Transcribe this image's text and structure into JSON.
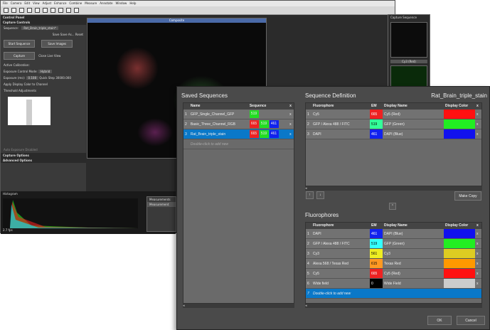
{
  "app": {
    "menu": [
      "File",
      "Camera",
      "Edit",
      "View",
      "Adjust",
      "Enhance",
      "Combine",
      "Measure",
      "Annotate",
      "Window",
      "Help"
    ]
  },
  "control_panel": {
    "title": "Control Panel",
    "section": "Capture Controls",
    "sequence_label": "Sequence:",
    "sequence_value": "Rat_Brain_triple_stain*",
    "save_label": "Save",
    "save_as_label": "Save As...",
    "reset_label": "Reset",
    "start_sequence": "Start Sequence",
    "save_images": "Save Images",
    "capture": "Capture",
    "close_live_view": "Close Live View",
    "active_calibration": "Active Calibration:",
    "exposure_control_mode_label": "Exposure Control Mode:",
    "exposure_control_mode_value": "Hybrid",
    "exposure_label": "Exposure (ms):",
    "exposure_value": "0.108",
    "exposure_button": "Quick Step",
    "exposure_max": "30000.000",
    "apply_display_color": "Apply Display Color to Channel",
    "threshold_adjustments": "Threshold Adjustments",
    "auto_exposure_disabled": "Auto Exposure Disabled",
    "capture_options": "Capture Options",
    "advanced_options": "Advanced Options",
    "histogram": "Histogram",
    "fps": "2.7 fps"
  },
  "composite": {
    "title": "Composite"
  },
  "capture_sequence": {
    "title": "Capture Sequence",
    "thumb_label": "Cy3 (Red)"
  },
  "measurements": {
    "title": "Measurements",
    "col": "Measurement"
  },
  "dialog": {
    "saved_sequences": {
      "title": "Saved Sequences",
      "headers": [
        "Name",
        "Sequence",
        "x"
      ],
      "rows": [
        {
          "n": "1",
          "name": "GFP_Single_Channel_GFP",
          "seq": [
            {
              "v": "519",
              "c": "#22dd22"
            }
          ]
        },
        {
          "n": "2",
          "name": "Basic_Three_Channel_RGB",
          "seq": [
            {
              "v": "665",
              "c": "#ee2222"
            },
            {
              "v": "519",
              "c": "#22dd22"
            },
            {
              "v": "461",
              "c": "#1122ee"
            }
          ]
        },
        {
          "n": "3",
          "name": "Rat_Brain_triple_stain",
          "seq": [
            {
              "v": "665",
              "c": "#ee2222"
            },
            {
              "v": "519",
              "c": "#22dd22"
            },
            {
              "v": "461",
              "c": "#1122ee"
            }
          ]
        }
      ],
      "add_row": "Double-click to add new"
    },
    "sequence_definition": {
      "title": "Sequence Definition",
      "name": "Rat_Brain_triple_stain",
      "headers": [
        "Fluorophore",
        "EM",
        "Display Name",
        "Display Color",
        "x"
      ],
      "rows": [
        {
          "n": "1",
          "fluor": "Cy5",
          "em": "665",
          "em_color": "#ee2222",
          "display": "Cy5 (Red)",
          "color": "#ff1111"
        },
        {
          "n": "2",
          "fluor": "GFP / Alexa 488 / FITC",
          "em": "519",
          "em_color": "#33ff99",
          "display": "GFP (Green)",
          "color": "#22ee22"
        },
        {
          "n": "3",
          "fluor": "DAPI",
          "em": "461",
          "em_color": "#1122ee",
          "display": "DAPI (Blue)",
          "color": "#1111ee"
        }
      ],
      "make_copy": "Make Copy"
    },
    "fluorophores": {
      "title": "Fluorophores",
      "headers": [
        "Fluorophore",
        "EM",
        "Display Name",
        "Display Color",
        "x"
      ],
      "rows": [
        {
          "n": "1",
          "fluor": "DAPI",
          "em": "461",
          "em_color": "#1122ee",
          "display": "DAPI (Blue)",
          "color": "#1111ee"
        },
        {
          "n": "2",
          "fluor": "GFP / Alexa 488 / FITC",
          "em": "519",
          "em_color": "#33ffff",
          "display": "GFP (Green)",
          "color": "#22ee22"
        },
        {
          "n": "3",
          "fluor": "Cy3",
          "em": "561",
          "em_color": "#eeee22",
          "display": "Cy3",
          "color": "#ddcc22"
        },
        {
          "n": "4",
          "fluor": "Alexa 568 / Texas Red",
          "em": "615",
          "em_color": "#ff9922",
          "display": "Texas Red",
          "color": "#ff9900"
        },
        {
          "n": "5",
          "fluor": "Cy5",
          "em": "665",
          "em_color": "#ee2222",
          "display": "Cy5 (Red)",
          "color": "#ff1111"
        },
        {
          "n": "6",
          "fluor": "Wide field",
          "em": "0",
          "em_color": "#000000",
          "display": "Wide Field",
          "color": "#cccccc"
        }
      ],
      "add_row_n": "7",
      "add_row": "Double-click to add new"
    },
    "ok": "OK",
    "cancel": "Cancel"
  }
}
